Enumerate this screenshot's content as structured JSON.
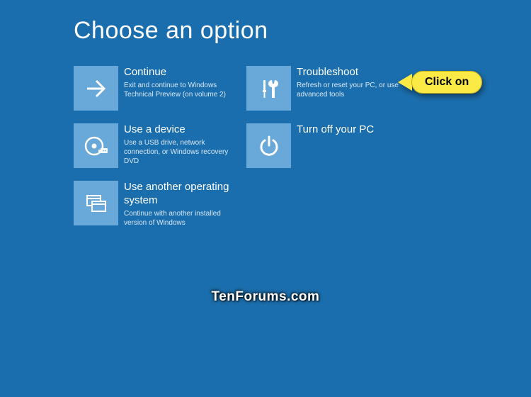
{
  "header": {
    "title": "Choose an option"
  },
  "options": {
    "continue": {
      "title": "Continue",
      "desc": "Exit and continue to Windows Technical Preview (on volume 2)"
    },
    "troubleshoot": {
      "title": "Troubleshoot",
      "desc": "Refresh or reset your PC, or use advanced tools"
    },
    "use_device": {
      "title": "Use a device",
      "desc": "Use a USB drive, network connection, or Windows recovery DVD"
    },
    "turn_off": {
      "title": "Turn off your PC",
      "desc": ""
    },
    "use_another_os": {
      "title": "Use another operating system",
      "desc": "Continue with another installed version of Windows"
    }
  },
  "callout": {
    "label": "Click on"
  },
  "watermark": {
    "text": "TenForums.com"
  },
  "colors": {
    "background": "#1b6ead",
    "tile": "#69a9da",
    "callout_bg": "#fbe946"
  }
}
